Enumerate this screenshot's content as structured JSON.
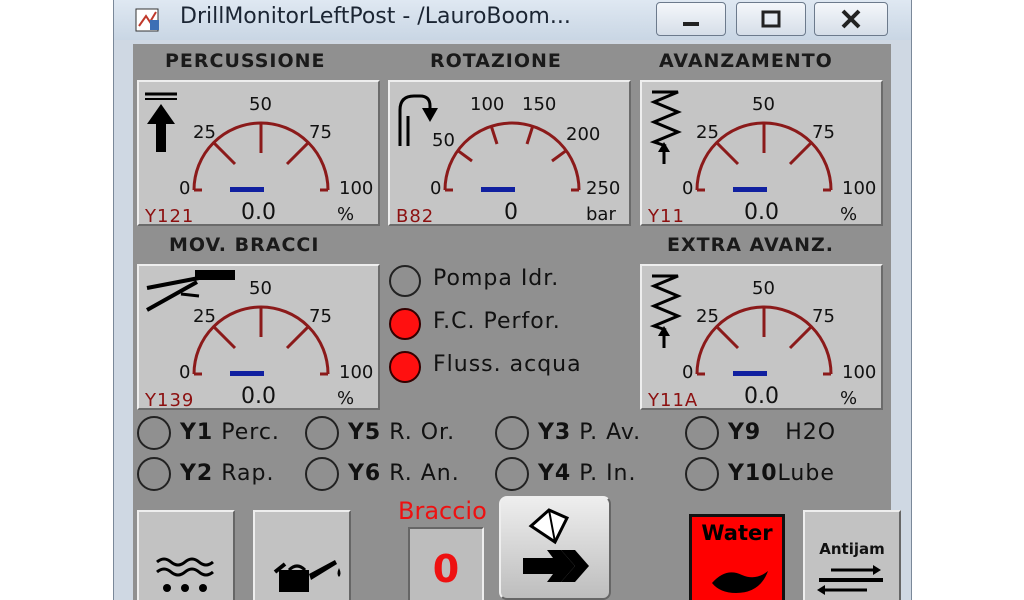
{
  "window": {
    "title": "DrillMonitorLeftPost - /LauroBoom..."
  },
  "gauges": {
    "percussione": {
      "title": "PERCUSSIONE",
      "ticks": [
        "0",
        "25",
        "50",
        "75",
        "100"
      ],
      "code": "Y121",
      "value": "0.0",
      "unit": "%",
      "icon": "arrow-up-icon"
    },
    "rotazione": {
      "title": "ROTAZIONE",
      "ticks": [
        "0",
        "50",
        "100",
        "150",
        "200",
        "250"
      ],
      "code": "B82",
      "value": "0",
      "unit": "bar",
      "icon": "rotation-arrow-icon"
    },
    "avanzamento": {
      "title": "AVANZAMENTO",
      "ticks": [
        "0",
        "25",
        "50",
        "75",
        "100"
      ],
      "code": "Y11",
      "value": "0.0",
      "unit": "%",
      "icon": "spring-feed-icon"
    },
    "mov_bracci": {
      "title": "MOV. BRACCI",
      "ticks": [
        "0",
        "25",
        "50",
        "75",
        "100"
      ],
      "code": "Y139",
      "value": "0.0",
      "unit": "%",
      "icon": "boom-icon"
    },
    "extra_avanz": {
      "title": "EXTRA AVANZ.",
      "ticks": [
        "0",
        "25",
        "50",
        "75",
        "100"
      ],
      "code": "Y11A",
      "value": "0.0",
      "unit": "%",
      "icon": "spring-feed-icon"
    }
  },
  "lamps": [
    {
      "label": "Pompa Idr.",
      "state": "off"
    },
    {
      "label": "F.C. Perfor.",
      "state": "on"
    },
    {
      "label": "Fluss. acqua",
      "state": "on"
    }
  ],
  "outputs": [
    {
      "code": "Y1",
      "label": " Perc."
    },
    {
      "code": "Y5",
      "label": " R. Or."
    },
    {
      "code": "Y3",
      "label": " P. Av."
    },
    {
      "code": "Y9",
      "label": "   H2O"
    },
    {
      "code": "Y2",
      "label": " Rap."
    },
    {
      "code": "Y6",
      "label": " R. An."
    },
    {
      "code": "Y4",
      "label": " P. In."
    },
    {
      "code": "Y10",
      "label": "Lube"
    }
  ],
  "braccio": {
    "label": "Braccio",
    "value": "0"
  },
  "buttons": {
    "water": "Water",
    "antijam": "Antijam"
  },
  "colors": {
    "dial": "#8b1a1a",
    "needle": "#1020a0",
    "led_on": "#ff1010",
    "accent_red": "#ee1111"
  }
}
